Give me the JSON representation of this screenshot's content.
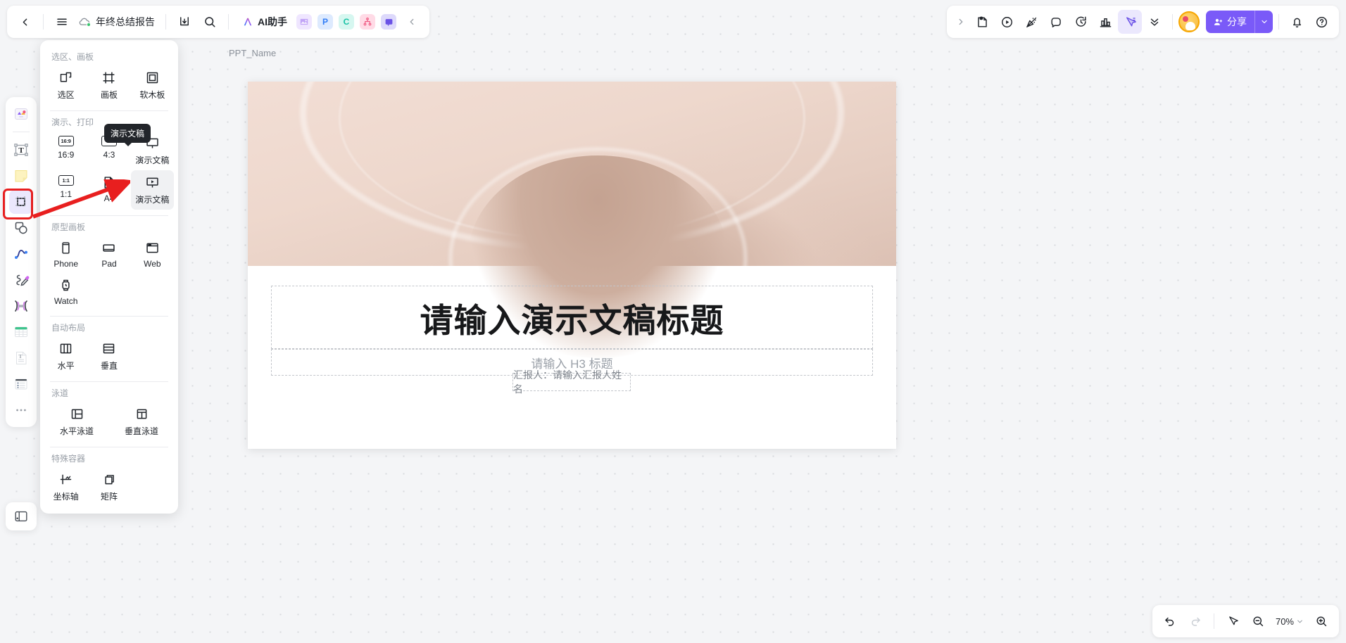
{
  "topbar": {
    "back_icon": "chevron-left-icon",
    "menu_icon": "hamburger-menu-icon",
    "cloud_icon": "cloud-sync-icon",
    "doc_title": "年终总结报告",
    "export_icon": "download-icon",
    "search_icon": "search-icon",
    "ai_label": "AI助手",
    "ai_icon": "ai-sparkle-icon",
    "applets": [
      {
        "name": "image-applet",
        "glyph": "◪",
        "color": "#c9a7f7",
        "bg": "#efe6ff"
      },
      {
        "name": "prototype-applet",
        "glyph": "P",
        "color": "#2f7cf6",
        "bg": "#ddeafe"
      },
      {
        "name": "flow-applet",
        "glyph": "C",
        "color": "#17c2a4",
        "bg": "#d6f7f0"
      },
      {
        "name": "mindmap-applet",
        "glyph": "⁂",
        "color": "#f05a82",
        "bg": "#ffdbe6"
      },
      {
        "name": "comment-applet",
        "glyph": "▣",
        "color": "#6a51e6",
        "bg": "#ddd9fb"
      }
    ],
    "collapse_left_icon": "chevron-left-icon",
    "expand_right_icon": "chevron-right-icon",
    "right_icons": [
      {
        "name": "sticky-note-icon"
      },
      {
        "name": "play-circle-icon"
      },
      {
        "name": "celebrate-icon"
      },
      {
        "name": "comment-bubble-icon"
      },
      {
        "name": "timer-icon"
      },
      {
        "name": "vote-chart-icon"
      },
      {
        "name": "cursor-pointer-icon"
      },
      {
        "name": "double-chevron-down-icon"
      }
    ],
    "avatar_name": "user-avatar",
    "share_label": "分享",
    "share_icon": "share-person-icon",
    "share_caret_icon": "chevron-down-icon",
    "bell_icon": "bell-icon",
    "help_icon": "help-circle-icon"
  },
  "rail": {
    "items": [
      {
        "name": "sidebar-item-templates",
        "icon": "template-gallery-icon"
      },
      {
        "name": "sidebar-item-text",
        "icon": "text-T-icon"
      },
      {
        "name": "sidebar-item-sticky",
        "icon": "sticky-note-icon"
      },
      {
        "name": "sidebar-item-frame",
        "icon": "frame-artboard-icon",
        "selected": true
      },
      {
        "name": "sidebar-item-shape",
        "icon": "shapes-icon"
      },
      {
        "name": "sidebar-item-connector",
        "icon": "curve-line-icon"
      },
      {
        "name": "sidebar-item-pen",
        "icon": "pen-draw-icon"
      },
      {
        "name": "sidebar-item-relation",
        "icon": "relation-node-icon"
      },
      {
        "name": "sidebar-item-table",
        "icon": "table-icon"
      },
      {
        "name": "sidebar-item-doc",
        "icon": "document-icon"
      },
      {
        "name": "sidebar-item-list",
        "icon": "list-board-icon"
      },
      {
        "name": "sidebar-item-more",
        "icon": "more-dots-icon"
      }
    ],
    "bottom_item": {
      "name": "sidebar-item-layers",
      "icon": "layers-panel-icon"
    }
  },
  "flyout": {
    "tooltip": "演示文稿",
    "groups": [
      {
        "title": "选区、画板",
        "items": [
          {
            "label": "选区",
            "icon": "selection-icon"
          },
          {
            "label": "画板",
            "icon": "artboard-icon"
          },
          {
            "label": "软木板",
            "icon": "corkboard-icon"
          }
        ]
      },
      {
        "title": "演示、打印",
        "items": [
          {
            "label": "16:9",
            "icon": "ratio-16-9-icon",
            "badge": "16:9"
          },
          {
            "label": "4:3",
            "icon": "ratio-4-3-icon",
            "badge": "4:3"
          },
          {
            "label": "演示文稿",
            "icon": "presentation-icon",
            "cut": true
          },
          {
            "label": "1:1",
            "icon": "ratio-1-1-icon",
            "badge": "1:1"
          },
          {
            "label": "A4",
            "icon": "a4-page-icon"
          },
          {
            "label": "演示文稿",
            "icon": "presentation-screen-icon",
            "hovered": true
          }
        ]
      },
      {
        "title": "原型画板",
        "items": [
          {
            "label": "Phone",
            "icon": "phone-icon"
          },
          {
            "label": "Pad",
            "icon": "tablet-icon"
          },
          {
            "label": "Web",
            "icon": "web-browser-icon"
          },
          {
            "label": "Watch",
            "icon": "watch-icon"
          }
        ]
      },
      {
        "title": "自动布局",
        "items": [
          {
            "label": "水平",
            "icon": "horizontal-layout-icon"
          },
          {
            "label": "垂直",
            "icon": "vertical-layout-icon"
          }
        ]
      },
      {
        "title": "泳道",
        "items": [
          {
            "label": "水平泳道",
            "icon": "horizontal-swimlane-icon"
          },
          {
            "label": "垂直泳道",
            "icon": "vertical-swimlane-icon"
          }
        ]
      },
      {
        "title": "特殊容器",
        "items": [
          {
            "label": "坐标轴",
            "icon": "axis-chart-icon"
          },
          {
            "label": "矩阵",
            "icon": "matrix-icon"
          }
        ]
      }
    ]
  },
  "canvas": {
    "slide_name": "PPT_Name",
    "title_placeholder": "请输入演示文稿标题",
    "subtitle_placeholder": "请输入 H3 标题",
    "reporter_placeholder": "汇报人：请输入汇报人姓名"
  },
  "bottombar": {
    "undo_icon": "undo-icon",
    "redo_icon": "redo-icon",
    "pointer_icon": "cursor-pointer-icon",
    "zoom_out_icon": "zoom-out-icon",
    "zoom_in_icon": "zoom-in-icon",
    "zoom_value": "70%",
    "zoom_caret_icon": "chevron-down-icon"
  },
  "colors": {
    "accent": "#7a5af8",
    "accent_soft": "#ebe8fd",
    "annotation_red": "#e81f1f",
    "canvas_bg": "#f4f5f7"
  }
}
